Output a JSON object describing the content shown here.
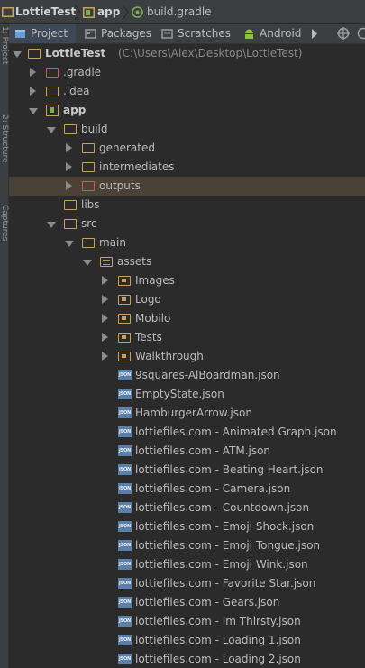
{
  "breadcrumbs": [
    "LottieTest",
    "app",
    "build.gradle"
  ],
  "tabs": [
    {
      "label": "Project",
      "icon": "project-icon",
      "active": true
    },
    {
      "label": "Packages",
      "icon": "packages-icon",
      "active": false
    },
    {
      "label": "Scratches",
      "icon": "scratches-icon",
      "active": false
    },
    {
      "label": "Android",
      "icon": "android-icon",
      "active": false
    }
  ],
  "side_stripe": [
    "1: Project",
    "2: Structure",
    "Captures"
  ],
  "tree": {
    "root_name": "LottieTest",
    "root_path": "(C:\\Users\\Alex\\Desktop\\LottieTest)",
    "items": [
      {
        "label": ".gradle",
        "icon": "folder-excluded-icon"
      },
      {
        "label": ".idea",
        "icon": "folder-icon"
      },
      {
        "label": "app",
        "icon": "module-icon"
      },
      {
        "label": "build",
        "icon": "folder-icon"
      },
      {
        "label": "generated",
        "icon": "folder-icon"
      },
      {
        "label": "intermediates",
        "icon": "folder-icon"
      },
      {
        "label": "outputs",
        "icon": "folder-excluded-icon"
      },
      {
        "label": "libs",
        "icon": "folder-icon"
      },
      {
        "label": "src",
        "icon": "folder-icon"
      },
      {
        "label": "main",
        "icon": "folder-icon"
      },
      {
        "label": "assets",
        "icon": "assets-folder-icon"
      },
      {
        "label": "Images",
        "icon": "resource-folder-icon"
      },
      {
        "label": "Logo",
        "icon": "resource-folder-icon"
      },
      {
        "label": "Mobilo",
        "icon": "resource-folder-icon"
      },
      {
        "label": "Tests",
        "icon": "resource-folder-icon"
      },
      {
        "label": "Walkthrough",
        "icon": "resource-folder-icon"
      },
      {
        "label": "9squares-AlBoardman.json",
        "icon": "json-file-icon"
      },
      {
        "label": "EmptyState.json",
        "icon": "json-file-icon"
      },
      {
        "label": "HamburgerArrow.json",
        "icon": "json-file-icon"
      },
      {
        "label": "lottiefiles.com - Animated Graph.json",
        "icon": "json-file-icon"
      },
      {
        "label": "lottiefiles.com - ATM.json",
        "icon": "json-file-icon"
      },
      {
        "label": "lottiefiles.com - Beating Heart.json",
        "icon": "json-file-icon"
      },
      {
        "label": "lottiefiles.com - Camera.json",
        "icon": "json-file-icon"
      },
      {
        "label": "lottiefiles.com - Countdown.json",
        "icon": "json-file-icon"
      },
      {
        "label": "lottiefiles.com - Emoji Shock.json",
        "icon": "json-file-icon"
      },
      {
        "label": "lottiefiles.com - Emoji Tongue.json",
        "icon": "json-file-icon"
      },
      {
        "label": "lottiefiles.com - Emoji Wink.json",
        "icon": "json-file-icon"
      },
      {
        "label": "lottiefiles.com - Favorite Star.json",
        "icon": "json-file-icon"
      },
      {
        "label": "lottiefiles.com - Gears.json",
        "icon": "json-file-icon"
      },
      {
        "label": "lottiefiles.com - Im Thirsty.json",
        "icon": "json-file-icon"
      },
      {
        "label": "lottiefiles.com - Loading 1.json",
        "icon": "json-file-icon"
      },
      {
        "label": "lottiefiles.com - Loading 2.json",
        "icon": "json-file-icon"
      }
    ]
  },
  "json_badge": "JSON",
  "colors": {
    "background": "#2b2b2b",
    "panel": "#3c3f41",
    "folder": "#c9a25a",
    "excluded_folder": "#d5574d",
    "selection": "#4a4237"
  }
}
